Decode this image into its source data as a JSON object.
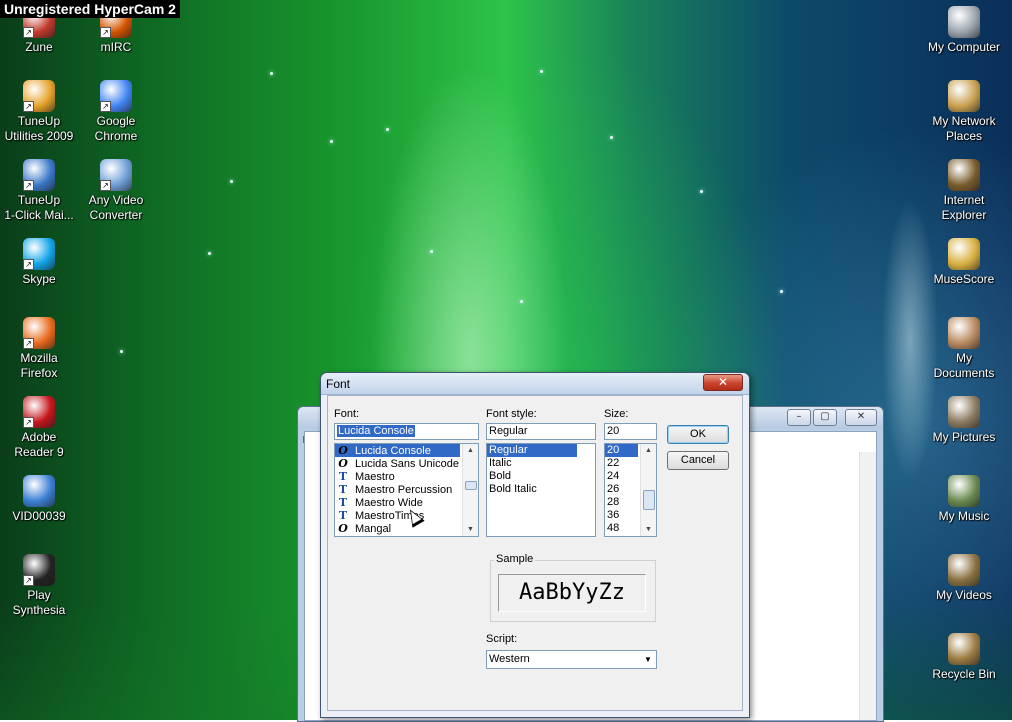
{
  "recorder": {
    "watermark": "Unregistered HyperCam 2"
  },
  "desktop": {
    "left_icons": [
      {
        "label": "Zune",
        "icon": "zune-icon",
        "color": "#c0392b",
        "shortcut": true
      },
      {
        "label": "mIRC",
        "icon": "mirc-icon",
        "color": "#d35400",
        "shortcut": true
      },
      {
        "label": "TuneUp\nUtilities 2009",
        "icon": "tuneup-utilities-icon",
        "color": "#e6a22a",
        "shortcut": true
      },
      {
        "label": "Google\nChrome",
        "icon": "chrome-icon",
        "color": "#4285f4",
        "shortcut": true
      },
      {
        "label": "TuneUp\n1-Click Mai...",
        "icon": "tuneup-1click-icon",
        "color": "#3a78c8",
        "shortcut": true
      },
      {
        "label": "Any Video\nConverter",
        "icon": "any-video-converter-icon",
        "color": "#6f9fd8",
        "shortcut": true
      },
      {
        "label": "Skype",
        "icon": "skype-icon",
        "color": "#12a5e8",
        "shortcut": true
      },
      {
        "label": "Mozilla\nFirefox",
        "icon": "firefox-icon",
        "color": "#e86a1c",
        "shortcut": true
      },
      {
        "label": "Adobe\nReader 9",
        "icon": "adobe-reader-icon",
        "color": "#c4161c",
        "shortcut": true
      },
      {
        "label": "VID00039",
        "icon": "video-file-icon",
        "color": "#3b7fd4",
        "shortcut": false
      },
      {
        "label": "Play\nSynthesia",
        "icon": "synthesia-icon",
        "color": "#222222",
        "shortcut": true
      }
    ],
    "right_icons": [
      {
        "label": "My Computer",
        "icon": "my-computer-icon",
        "color": "#9aa3ad"
      },
      {
        "label": "My Network\nPlaces",
        "icon": "network-places-icon",
        "color": "#c8a050"
      },
      {
        "label": "Internet\nExplorer",
        "icon": "internet-explorer-icon",
        "color": "#7a5c2e"
      },
      {
        "label": "MuseScore",
        "icon": "musescore-icon",
        "color": "#d8b040"
      },
      {
        "label": "My\nDocuments",
        "icon": "my-documents-icon",
        "color": "#b88a60"
      },
      {
        "label": "My Pictures",
        "icon": "my-pictures-icon",
        "color": "#8a7a60"
      },
      {
        "label": "My Music",
        "icon": "my-music-icon",
        "color": "#6a8a50"
      },
      {
        "label": "My Videos",
        "icon": "my-videos-icon",
        "color": "#8a7040"
      },
      {
        "label": "Recycle Bin",
        "icon": "recycle-bin-icon",
        "color": "#9a7a40"
      }
    ]
  },
  "back_window": {
    "menu_fragment": "Fi"
  },
  "font_dialog": {
    "title": "Font",
    "close_symbol": "✕",
    "font_label": "Font:",
    "font_value": "Lucida Console",
    "font_list": [
      {
        "name": "Lucida Console",
        "type": "opentype",
        "selected": true
      },
      {
        "name": "Lucida Sans Unicode",
        "type": "opentype",
        "selected": false
      },
      {
        "name": "Maestro",
        "type": "truetype",
        "selected": false
      },
      {
        "name": "Maestro Percussion",
        "type": "truetype",
        "selected": false
      },
      {
        "name": "Maestro Wide",
        "type": "truetype",
        "selected": false
      },
      {
        "name": "MaestroTimes",
        "type": "truetype",
        "selected": false
      },
      {
        "name": "Mangal",
        "type": "opentype",
        "selected": false
      }
    ],
    "style_label": "Font style:",
    "style_value": "Regular",
    "style_list": [
      {
        "name": "Regular",
        "selected": true
      },
      {
        "name": "Italic",
        "selected": false
      },
      {
        "name": "Bold",
        "selected": false
      },
      {
        "name": "Bold Italic",
        "selected": false
      }
    ],
    "size_label": "Size:",
    "size_value": "20",
    "size_list": [
      {
        "name": "20",
        "selected": true
      },
      {
        "name": "22",
        "selected": false
      },
      {
        "name": "24",
        "selected": false
      },
      {
        "name": "26",
        "selected": false
      },
      {
        "name": "28",
        "selected": false
      },
      {
        "name": "36",
        "selected": false
      },
      {
        "name": "48",
        "selected": false
      }
    ],
    "ok_label": "OK",
    "cancel_label": "Cancel",
    "sample_label": "Sample",
    "sample_text": "AaBbYyZz",
    "script_label": "Script:",
    "script_value": "Western"
  }
}
